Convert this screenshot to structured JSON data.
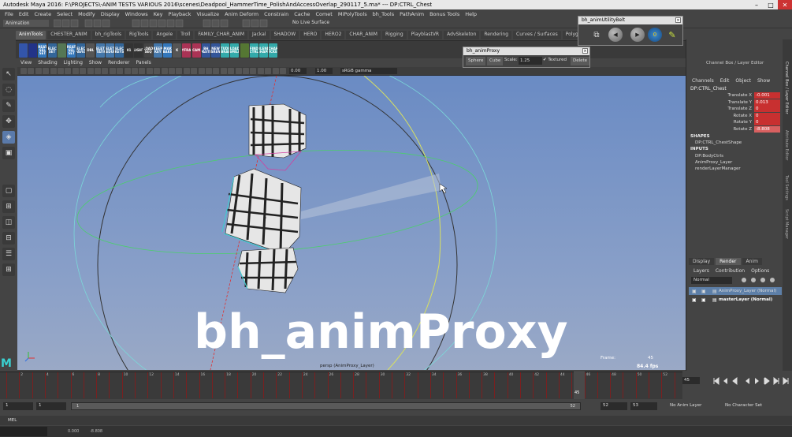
{
  "window": {
    "title": "Autodesk Maya 2016: F:\\PROJECTS\\-ANIM TESTS VARIOUS 2016\\scenes\\Deadpool_HammerTime_PolishAndAccessOverlap_290117_5.ma* --- DP:CTRL_Chest"
  },
  "menubar": [
    "File",
    "Edit",
    "Create",
    "Select",
    "Modify",
    "Display",
    "Windows",
    "Key",
    "Playback",
    "Visualize",
    "Anim Deform",
    "Constrain",
    "Cache",
    "Comet",
    "MiPolyTools",
    "bh_Tools",
    "PathAnim",
    "Bonus Tools",
    "Help"
  ],
  "status": {
    "mode": "Animation",
    "live_surface": "No Live Surface"
  },
  "shelf_tabs": [
    "AnimTools",
    "CHESTER_ANIM",
    "bh_rigTools",
    "RigTools",
    "Angele",
    "Troll",
    "FAMILY_CHAR_ANIM",
    "Jackal",
    "SHADOW",
    "HERO",
    "HERO2",
    "CHAR_ANIM",
    "Rigging",
    "PlayblastVR",
    "AdvSkeleton",
    "Rendering",
    "Curves / Surfaces",
    "Polygons",
    "AFR",
    "AndyS2",
    "Animation"
  ],
  "active_shelf_tab": "AnimTools",
  "shelf_icons": [
    {
      "label": "",
      "color": "#3355aa"
    },
    {
      "label": "",
      "color": "#223388"
    },
    {
      "label": "CREATE SEL SET",
      "color": "#3377bb"
    },
    {
      "label": "SELECT SET",
      "color": "#336699"
    },
    {
      "label": "",
      "color": "#557755"
    },
    {
      "label": "CREATE SEL SET",
      "color": "#3377bb"
    },
    {
      "label": "SELECT FAVES",
      "color": "#336699"
    },
    {
      "label": "DBL",
      "color": "#555"
    },
    {
      "label": "DELETE STATIC",
      "color": "#4477aa"
    },
    {
      "label": "DELETE REDUN",
      "color": "#4477aa"
    },
    {
      "label": "SELECT KEYS",
      "color": "#336699"
    },
    {
      "label": "01",
      "color": "#333"
    },
    {
      "label": "LIGHT",
      "color": "#333"
    },
    {
      "label": "LOAD SEQ",
      "color": "#444"
    },
    {
      "label": "KEEP KEY",
      "color": "#4477aa"
    },
    {
      "label": "SMART BAKE",
      "color": "#3377bb"
    },
    {
      "label": "K",
      "color": "#555"
    },
    {
      "label": "KEYFRAME",
      "color": "#aa3355"
    },
    {
      "label": "CAM",
      "color": "#aa3355"
    },
    {
      "label": "BH PASTE",
      "color": "#335599"
    },
    {
      "label": "NEW PARENT",
      "color": "#335599"
    },
    {
      "label": "STUDIO LIBRARY",
      "color": "#33aaaa"
    },
    {
      "label": "LOAD SMILE",
      "color": "#33aaaa"
    },
    {
      "label": "",
      "color": "#557733"
    },
    {
      "label": "FIND CTRL",
      "color": "#33aaaa"
    },
    {
      "label": "BLEND SHAPE",
      "color": "#33aaaa"
    },
    {
      "label": "CHAR PICKER",
      "color": "#33aaaa"
    }
  ],
  "shelf_right_icons": [
    {
      "label": "",
      "color": "#cc3333"
    },
    {
      "label": "",
      "color": "#aa8833"
    },
    {
      "label": "",
      "color": "#333"
    },
    {
      "label": "CAP VIEW",
      "color": "#333"
    },
    {
      "label": "BSE 3rde GRID",
      "color": "#333"
    },
    {
      "label": "KEY TYPE",
      "color": "#333"
    }
  ],
  "viewport": {
    "menu": [
      "View",
      "Shading",
      "Lighting",
      "Show",
      "Renderer",
      "Panels"
    ],
    "field1": "0.00",
    "field2": "1.00",
    "colorspace": "sRGB gamma",
    "camera_label": "persp (AnimProxy_Layer)",
    "frame_label": "Frame:",
    "frame_value": "45",
    "fps": "84.4 fps",
    "overlay_title": "bh_animProxy"
  },
  "anim_proxy_dialog": {
    "title": "bh_animProxy",
    "buttons": [
      "Sphere",
      "Cube"
    ],
    "scale_label": "Scale:",
    "scale_value": "1.25",
    "textured_label": "Textured",
    "textured_checked": true,
    "delete_label": "Delete"
  },
  "utility_belt": {
    "title": "bh_animUtilityBelt",
    "buttons": [
      "cam-icon",
      "prev-key-icon",
      "next-key-icon",
      "zero-icon",
      "pencil-icon"
    ]
  },
  "channel_box": {
    "title": "Channel Box / Layer Editor",
    "menu": [
      "Channels",
      "Edit",
      "Object",
      "Show"
    ],
    "node": "DP:CTRL_Chest",
    "attributes": [
      {
        "name": "Translate X",
        "value": "-0.001"
      },
      {
        "name": "Translate Y",
        "value": "0.013"
      },
      {
        "name": "Translate Z",
        "value": "0"
      },
      {
        "name": "Rotate X",
        "value": "0"
      },
      {
        "name": "Rotate Y",
        "value": "0"
      },
      {
        "name": "Rotate Z",
        "value": "-8.808"
      }
    ],
    "shapes_header": "SHAPES",
    "shapes": [
      "DP:CTRL_ChestShape"
    ],
    "inputs_header": "INPUTS",
    "inputs": [
      "DP:BodyCtrls",
      "AnimProxy_Layer",
      "renderLayerManager"
    ]
  },
  "side_tabs": [
    "Channel Box / Layer Editor",
    "Attribute Editor",
    "Tool Settings",
    "Script Manager"
  ],
  "layer_editor": {
    "tabs": [
      "Display",
      "Render",
      "Anim"
    ],
    "active_tab": "Render",
    "menu": [
      "Layers",
      "Contribution",
      "Options"
    ],
    "blend": "Normal",
    "layers": [
      {
        "name": "AnimProxy_Layer (Normal)",
        "selected": true
      },
      {
        "name": "masterLayer (Normal)",
        "selected": false
      }
    ]
  },
  "timeline": {
    "ticks": [
      "2",
      "4",
      "6",
      "8",
      "10",
      "12",
      "14",
      "16",
      "18",
      "20",
      "22",
      "24",
      "26",
      "28",
      "30",
      "32",
      "34",
      "36",
      "38",
      "40",
      "42",
      "44",
      "46",
      "48",
      "50",
      "52"
    ],
    "current": "45",
    "current_field": "45"
  },
  "range": {
    "start": "1",
    "start_inner": "1",
    "slider_start": "1",
    "slider_end": "52",
    "end_inner": "52",
    "end": "53",
    "anim_layer": "No Anim Layer",
    "char_set": "No Character Set"
  },
  "cmd": {
    "label": "MEL"
  },
  "help": {
    "left": "0.000",
    "right": "-8.808"
  }
}
